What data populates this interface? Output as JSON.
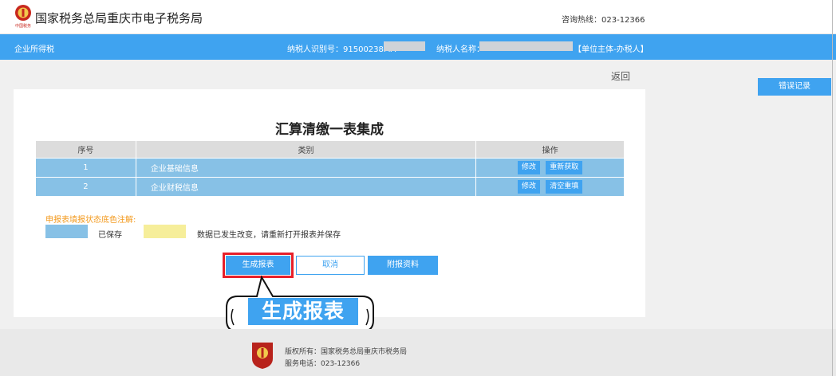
{
  "header": {
    "site_title": "国家税务总局重庆市电子税务局",
    "hotline": "咨询热线：023-12366"
  },
  "subbar": {
    "section": "企业所得税",
    "taxpayer_id_label": "纳税人识别号：91500238MA",
    "taxpayer_name_label": "纳税人名称：",
    "role": "【单位主体-办税人】"
  },
  "actions": {
    "back": "返回",
    "error_log": "错误记录"
  },
  "main": {
    "title": "汇算清缴一表集成",
    "columns": [
      "序号",
      "类别",
      "操作"
    ],
    "rows": [
      {
        "no": "1",
        "category": "企业基础信息",
        "op1": "修改",
        "op2": "重新获取"
      },
      {
        "no": "2",
        "category": "企业财税信息",
        "op1": "修改",
        "op2": "清空重填"
      }
    ],
    "legend": {
      "title": "申报表填报状态底色注解:",
      "saved": "已保存",
      "changed": "数据已发生改变，请重新打开报表并保存"
    },
    "buttons": {
      "generate": "生成报表",
      "cancel": "取消",
      "attach": "附报资料"
    }
  },
  "callout": {
    "text": "生成报表"
  },
  "footer": {
    "copyright": "版权所有：国家税务总局重庆市税务局",
    "phone": "服务电话：023-12366"
  },
  "colors": {
    "primary_blue": "#3fa3f0",
    "saved_row": "#87c1e6",
    "changed_swatch": "#f6ee9a",
    "highlight_red": "#e8202a",
    "legend_orange": "#f39a1e"
  }
}
